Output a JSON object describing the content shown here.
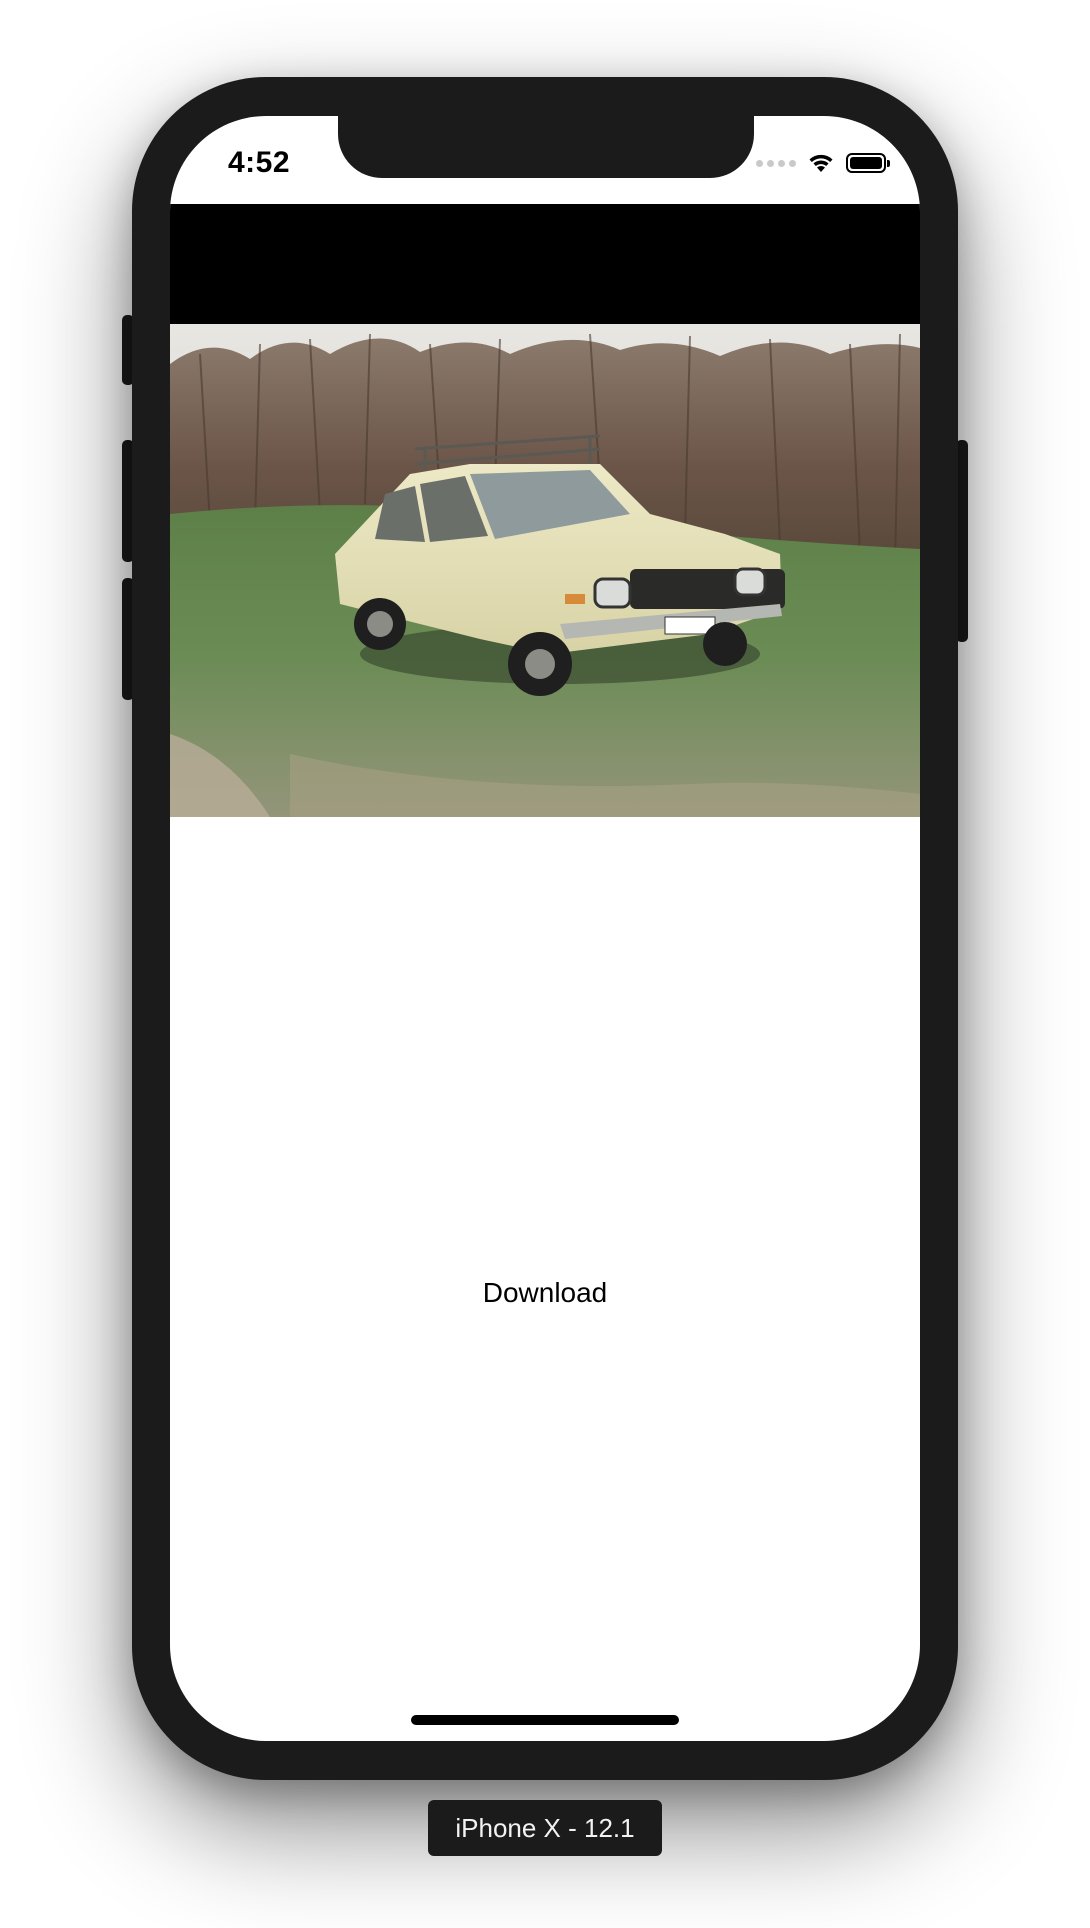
{
  "status_bar": {
    "time": "4:52",
    "icons": [
      "signal-dots-icon",
      "wifi-icon",
      "battery-icon"
    ]
  },
  "media": {
    "image_description_icon": "car-photo",
    "background_color": "#000000"
  },
  "actions": {
    "download_label": "Download"
  },
  "simulator": {
    "device_label": "iPhone X - 12.1"
  }
}
